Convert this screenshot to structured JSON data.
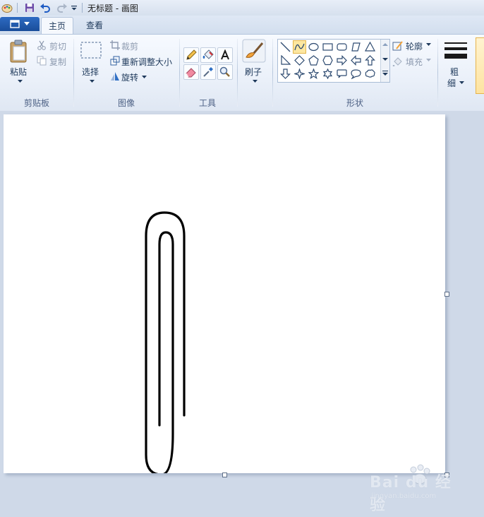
{
  "window": {
    "title": "无标题 - 画图"
  },
  "tabs": [
    {
      "label": "主页"
    },
    {
      "label": "查看"
    }
  ],
  "clipboard": {
    "paste_label": "粘贴",
    "cut_label": "剪切",
    "copy_label": "复制",
    "group_label": "剪贴板"
  },
  "image": {
    "select_label": "选择",
    "crop_label": "裁剪",
    "resize_label": "重新调整大小",
    "rotate_label": "旋转",
    "group_label": "图像"
  },
  "tools": {
    "group_label": "工具"
  },
  "brushes": {
    "label": "刷子"
  },
  "shapes": {
    "outline_label": "轮廓",
    "fill_label": "填充",
    "group_label": "形状",
    "selected_shape": "curve"
  },
  "size": {
    "label_line1": "粗",
    "label_line2": "细"
  },
  "watermark": {
    "main": "Bai du 经验",
    "sub": "jingyan.baidu.com"
  },
  "colors": {
    "accent": "#f2a33a",
    "tab_blue": "#2e6bc2",
    "canvas_bg": "#ffffff"
  }
}
